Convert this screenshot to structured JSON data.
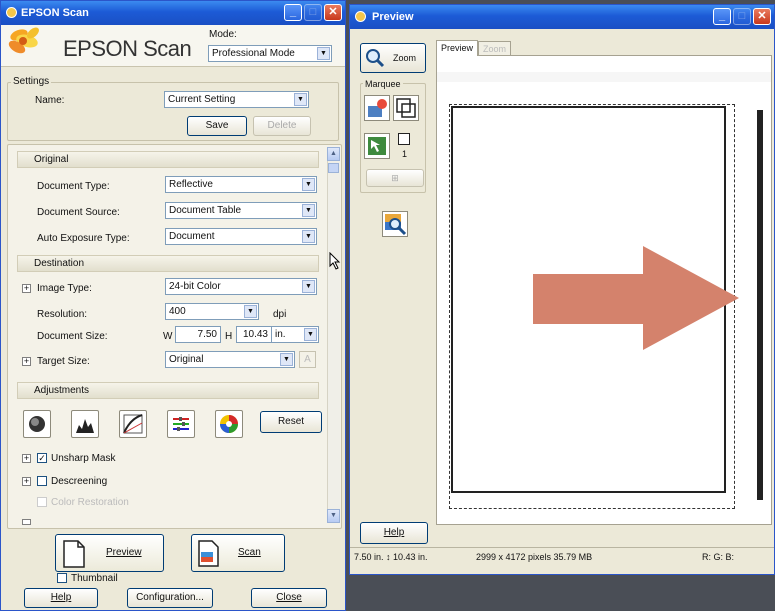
{
  "epson_window": {
    "title": "EPSON Scan",
    "logo_text": "EPSON Scan",
    "mode_label": "Mode:",
    "mode_value": "Professional Mode",
    "settings": {
      "group_label": "Settings",
      "name_label": "Name:",
      "name_value": "Current Setting",
      "save_label": "Save",
      "delete_label": "Delete"
    },
    "original": {
      "header": "Original",
      "document_type_label": "Document Type:",
      "document_type_value": "Reflective",
      "document_source_label": "Document Source:",
      "document_source_value": "Document Table",
      "auto_exposure_label": "Auto Exposure Type:",
      "auto_exposure_value": "Document"
    },
    "destination": {
      "header": "Destination",
      "image_type_label": "Image Type:",
      "image_type_value": "24-bit Color",
      "resolution_label": "Resolution:",
      "resolution_value": "400",
      "resolution_unit": "dpi",
      "document_size_label": "Document Size:",
      "w_label": "W",
      "w_value": "7.50",
      "h_label": "H",
      "h_value": "10.43",
      "size_unit": "in.",
      "target_size_label": "Target Size:",
      "target_size_value": "Original"
    },
    "adjustments": {
      "header": "Adjustments",
      "reset_label": "Reset",
      "unsharp_mask_label": "Unsharp Mask",
      "unsharp_mask_checked": true,
      "descreening_label": "Descreening",
      "descreening_checked": false,
      "color_restoration_label": "Color Restoration",
      "color_restoration_checked": false
    },
    "actions": {
      "preview_label": "Preview",
      "scan_label": "Scan",
      "thumbnail_label": "Thumbnail",
      "help_label": "Help",
      "configuration_label": "Configuration...",
      "close_label": "Close"
    }
  },
  "preview_window": {
    "title": "Preview",
    "zoom_button_label": "Zoom",
    "marquee_label": "Marquee",
    "marquee_count": "1",
    "tab_preview": "Preview",
    "tab_zoom": "Zoom",
    "help_label": "Help",
    "status": {
      "dimensions": "7.50 in. ↕ 10.43 in.",
      "pixels": "2999 x 4172 pixels 35.79 MB",
      "rgb": "R: G: B:"
    }
  },
  "colors": {
    "title_blue": "#1c5bd6",
    "window_bg": "#ece9d8",
    "arrow": "#d4826c",
    "desktop": "#4a4e56"
  }
}
